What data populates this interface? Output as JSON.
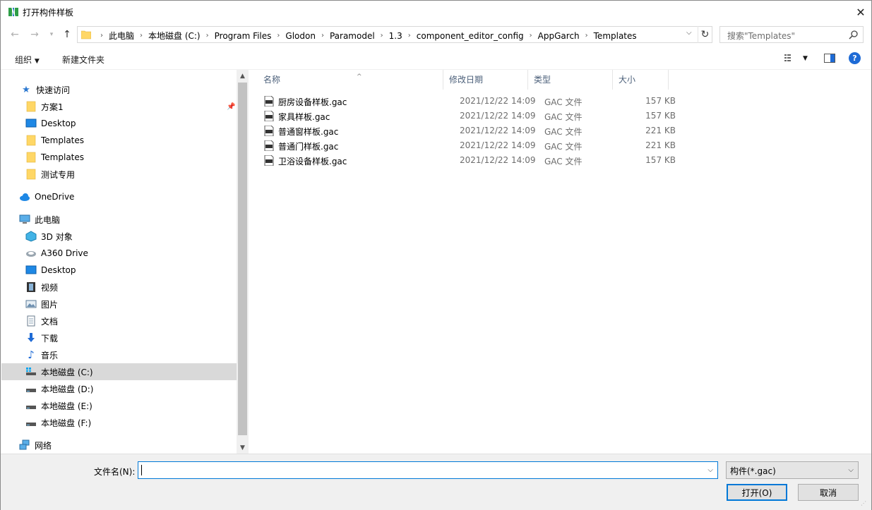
{
  "window": {
    "title": "打开构件样板"
  },
  "address": {
    "crumbs": [
      "此电脑",
      "本地磁盘 (C:)",
      "Program Files",
      "Glodon",
      "Paramodel",
      "1.3",
      "component_editor_config",
      "AppGarch",
      "Templates"
    ]
  },
  "search": {
    "placeholder": "搜索\"Templates\""
  },
  "toolbar": {
    "organize": "组织",
    "new_folder": "新建文件夹"
  },
  "nav": {
    "quick_access": "快速访问",
    "quick_items": [
      "方案1",
      "Desktop",
      "Templates",
      "Templates",
      "测试专用"
    ],
    "onedrive": "OneDrive",
    "this_pc": "此电脑",
    "pc_items": [
      "3D 对象",
      "A360 Drive",
      "Desktop",
      "视频",
      "图片",
      "文档",
      "下载",
      "音乐",
      "本地磁盘 (C:)",
      "本地磁盘 (D:)",
      "本地磁盘 (E:)",
      "本地磁盘 (F:)"
    ],
    "network": "网络"
  },
  "columns": {
    "name": "名称",
    "date": "修改日期",
    "type": "类型",
    "size": "大小"
  },
  "files": [
    {
      "name": "厨房设备样板.gac",
      "date": "2021/12/22 14:09",
      "type": "GAC 文件",
      "size": "157 KB"
    },
    {
      "name": "家具样板.gac",
      "date": "2021/12/22 14:09",
      "type": "GAC 文件",
      "size": "157 KB"
    },
    {
      "name": "普通窗样板.gac",
      "date": "2021/12/22 14:09",
      "type": "GAC 文件",
      "size": "221 KB"
    },
    {
      "name": "普通门样板.gac",
      "date": "2021/12/22 14:09",
      "type": "GAC 文件",
      "size": "221 KB"
    },
    {
      "name": "卫浴设备样板.gac",
      "date": "2021/12/22 14:09",
      "type": "GAC 文件",
      "size": "157 KB"
    }
  ],
  "footer": {
    "filename_label": "文件名(N):",
    "filename_value": "",
    "filter": "构件(*.gac)",
    "open": "打开(O)",
    "cancel": "取消"
  },
  "colors": {
    "accent": "#0078d7",
    "selected_bg": "#d9d9d9",
    "folder": "#ffd766"
  }
}
